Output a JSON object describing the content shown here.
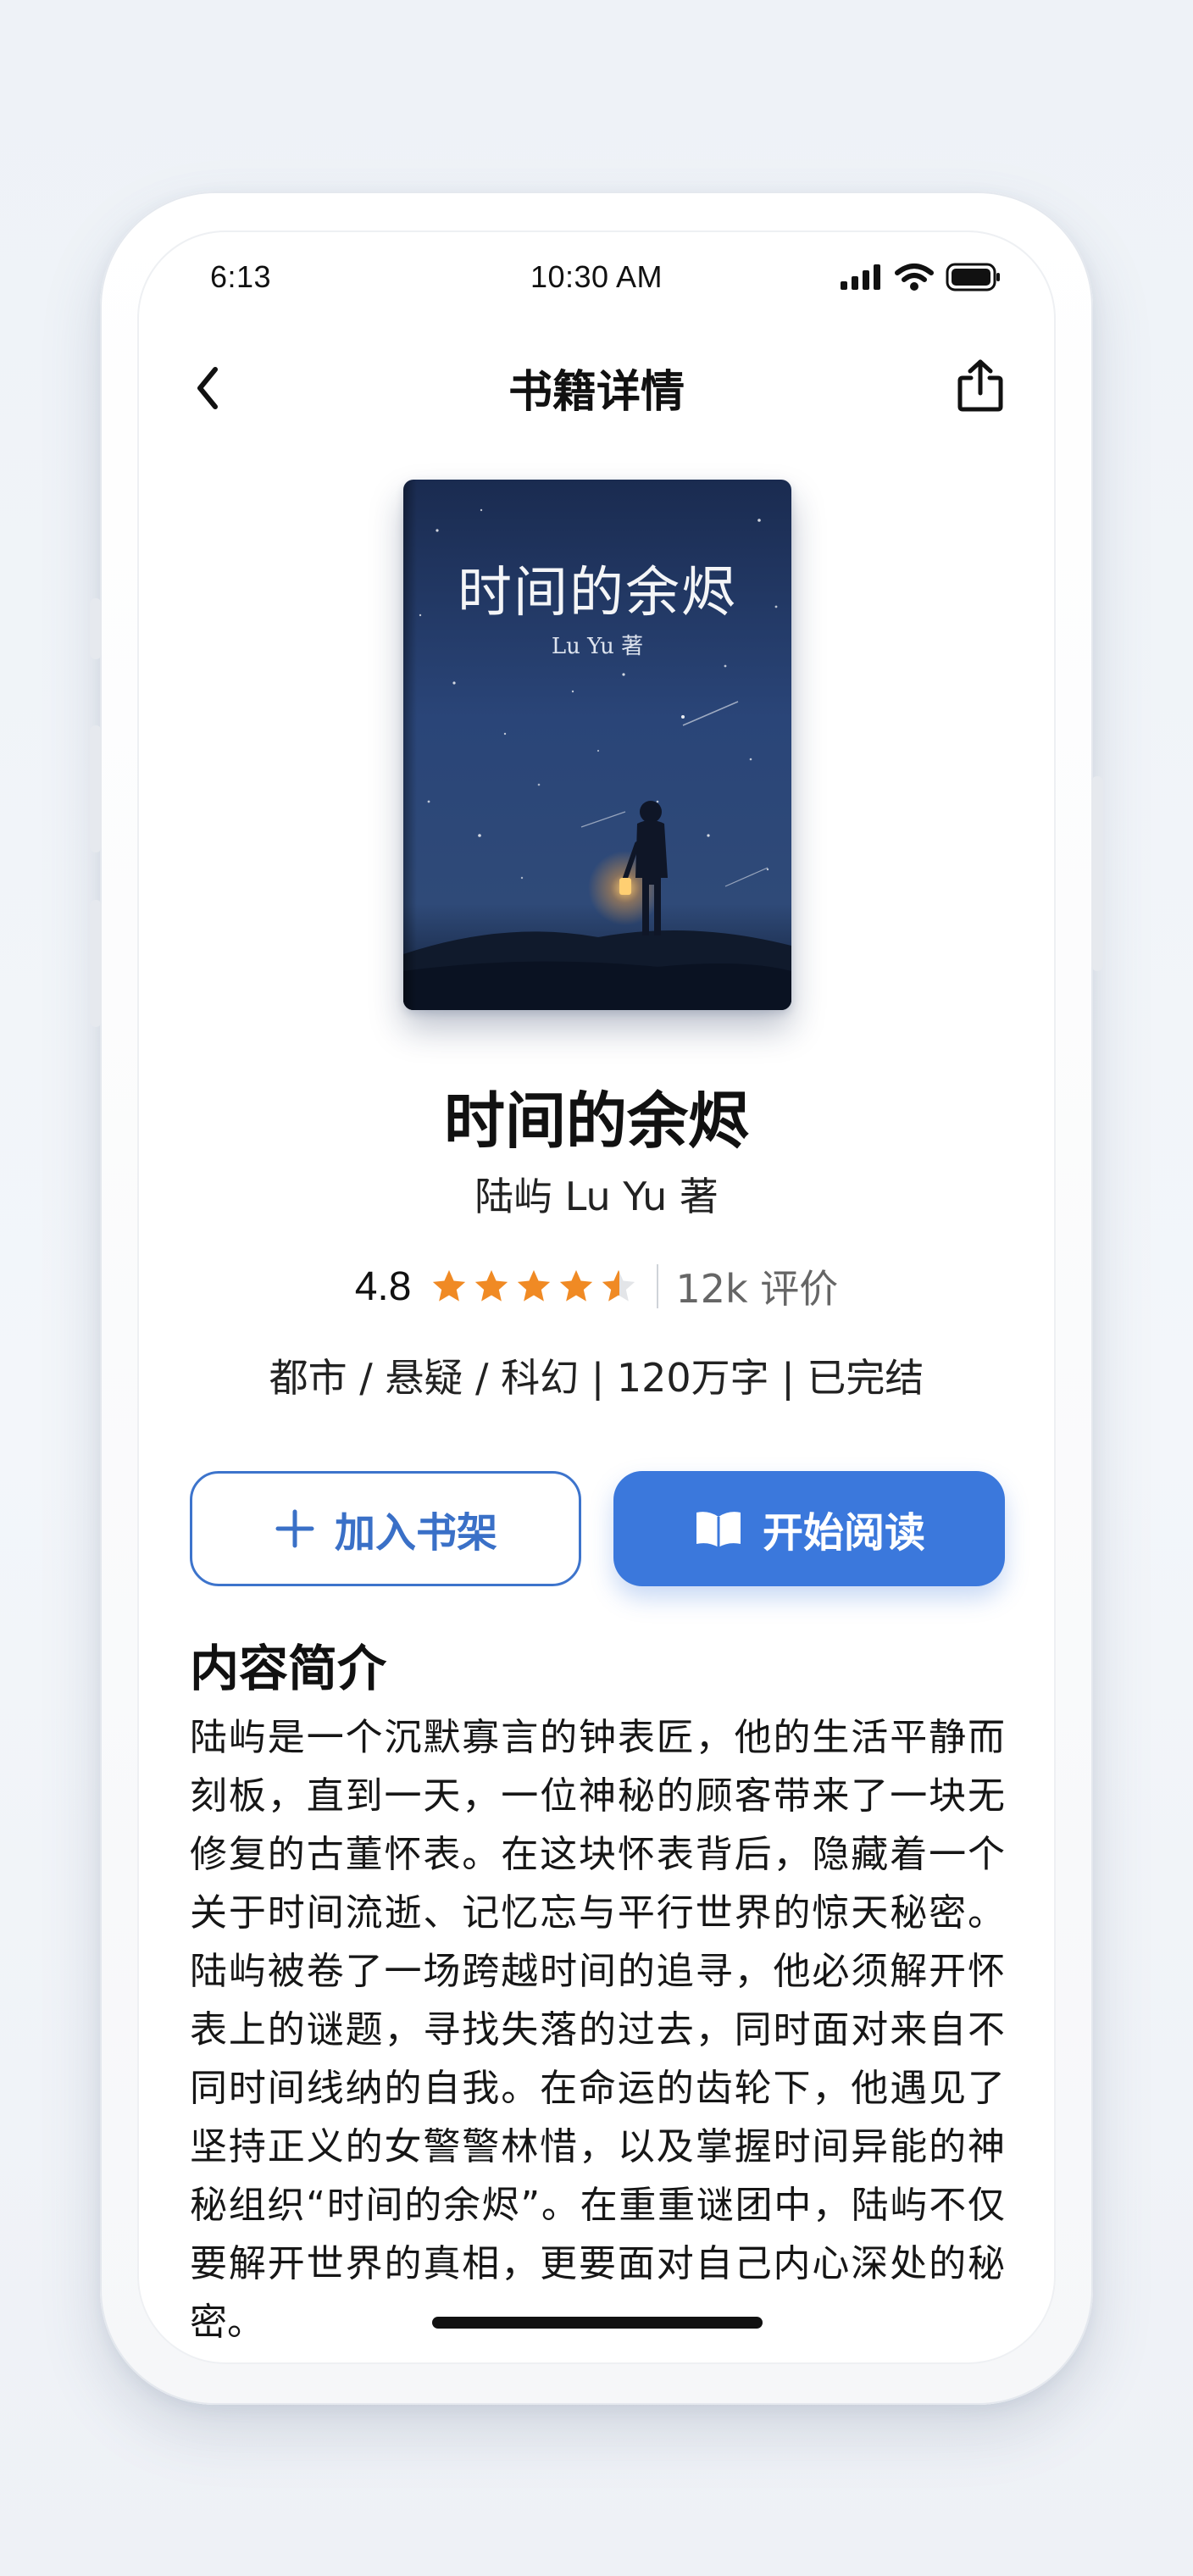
{
  "status_bar": {
    "left_time": "6:13",
    "center_time": "10:30 AM"
  },
  "nav": {
    "title": "书籍详情"
  },
  "cover": {
    "title": "时间的余烬",
    "author": "Lu Yu 著"
  },
  "book": {
    "title": "时间的余烬",
    "author": "陆屿 Lu Yu 著",
    "rating": "4.8",
    "rating_fraction": 0.96,
    "review_count": "12k 评价",
    "meta": "都市 / 悬疑 / 科幻 | 120万字 | 已完结"
  },
  "actions": {
    "add_label": "加入书架",
    "read_label": "开始阅读"
  },
  "synopsis": {
    "heading": "内容简介",
    "text": "陆屿是一个沉默寡言的钟表匠，他的生活平静而刻板，直到一天，一位神秘的顾客带来了一块无修复的古董怀表。在这块怀表背后，隐藏着一个关于时间流逝、记忆忘与平行世界的惊天秘密。陆屿被卷了一场跨越时间的追寻，他必须解开怀表上的谜题，寻找失落的过去，同时面对来自不同时间线纳的自我。在命运的齿轮下，他遇见了坚持正义的女警警林惜，以及掌握时间异能的神秘组织“时间的余烬”。在重重谜团中，陆屿不仅要解开世界的真相，更要面对自己内心深处的秘密。"
  },
  "colors": {
    "accent": "#3b78dc",
    "star": "#f08a24",
    "star_empty": "#e3e5e8"
  },
  "icons": [
    "back-icon",
    "share-icon",
    "signal-icon",
    "wifi-icon",
    "battery-icon",
    "star-icon",
    "plus-icon",
    "book-open-icon"
  ]
}
